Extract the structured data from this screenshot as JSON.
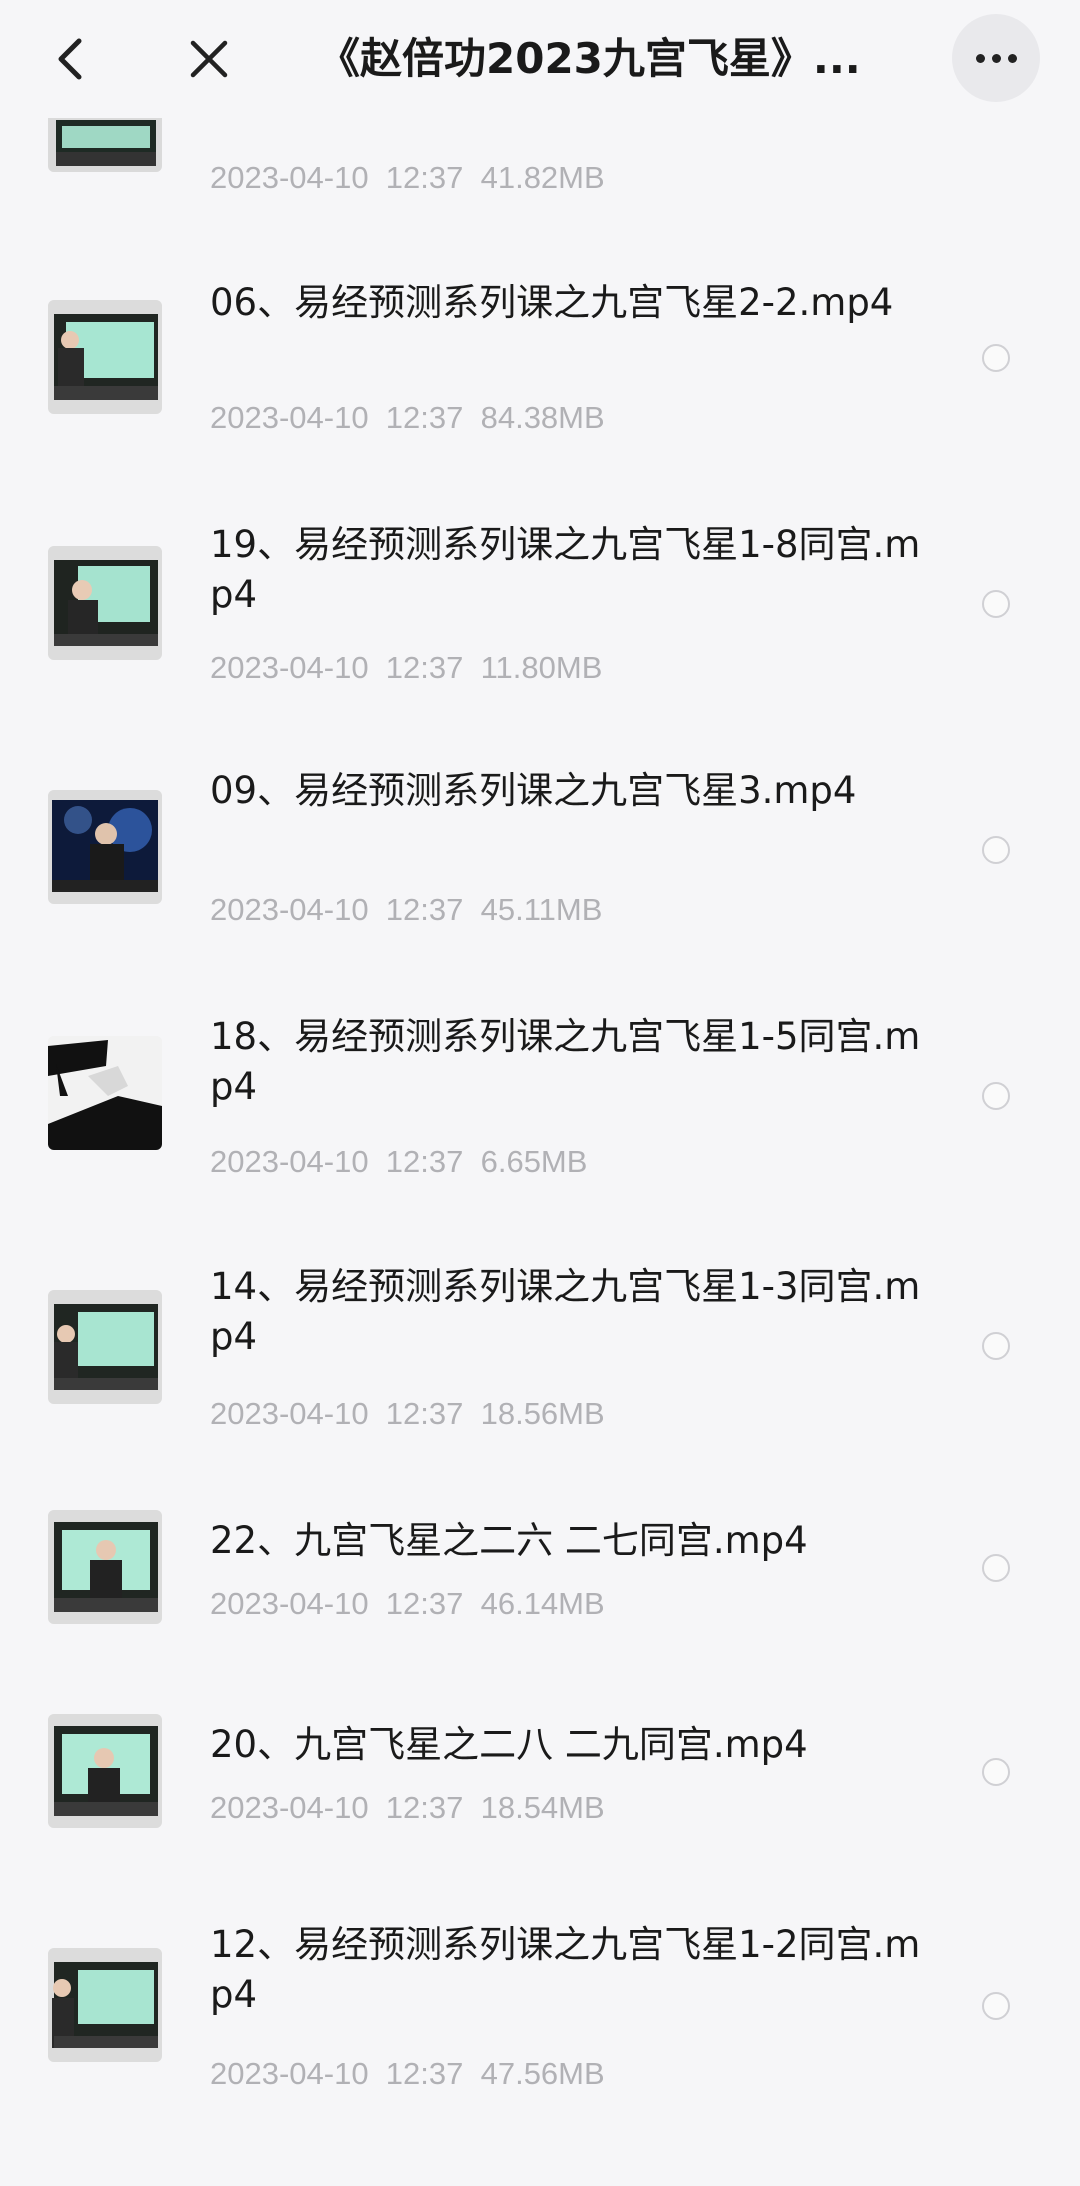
{
  "header": {
    "title": "《赵倍功2023九宫飞星》...",
    "back_icon": "chevron-left-icon",
    "close_icon": "close-icon",
    "more_icon": "more-horizontal-icon"
  },
  "partial_item": {
    "meta": "2023-04-10  12:37  41.82MB"
  },
  "files": [
    {
      "name": "06、易经预测系列课之九宫飞星2-2.mp4",
      "meta": "2023-04-10  12:37  84.38MB"
    },
    {
      "name": "19、易经预测系列课之九宫飞星1-8同宫.mp4",
      "meta": "2023-04-10  12:37  11.80MB"
    },
    {
      "name": "09、易经预测系列课之九宫飞星3.mp4",
      "meta": "2023-04-10  12:37  45.11MB"
    },
    {
      "name": "18、易经预测系列课之九宫飞星1-5同宫.mp4",
      "meta": "2023-04-10  12:37  6.65MB"
    },
    {
      "name": "14、易经预测系列课之九宫飞星1-3同宫.mp4",
      "meta": "2023-04-10  12:37  18.56MB"
    },
    {
      "name": "22、九宫飞星之二六 二七同宫.mp4",
      "meta": "2023-04-10  12:37  46.14MB"
    },
    {
      "name": "20、九宫飞星之二八 二九同宫.mp4",
      "meta": "2023-04-10  12:37  18.54MB"
    },
    {
      "name": "12、易经预测系列课之九宫飞星1-2同宫.mp4",
      "meta": "2023-04-10  12:37  47.56MB"
    }
  ]
}
